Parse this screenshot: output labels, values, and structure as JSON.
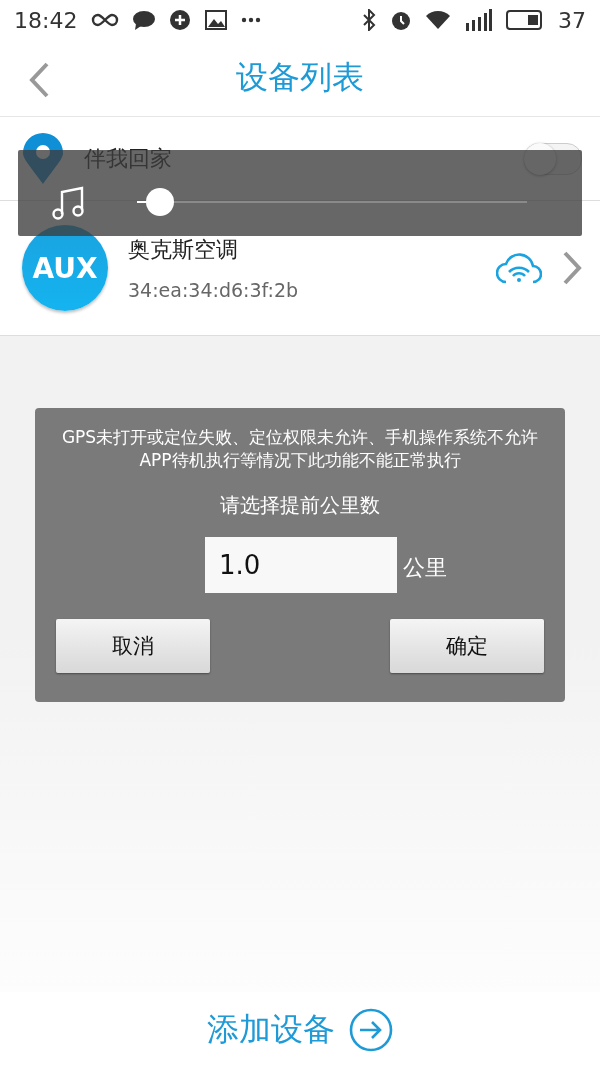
{
  "status_bar": {
    "time": "18:42",
    "battery": "37"
  },
  "header": {
    "title": "设备列表"
  },
  "devices": [
    {
      "kind": "toggle",
      "name": "伴我回家",
      "on": false
    },
    {
      "kind": "device",
      "name": "奥克斯空调",
      "logo": "AUX",
      "mac": "34:ea:34:d6:3f:2b"
    }
  ],
  "volume_overlay": {
    "level": 0.06
  },
  "dialog": {
    "message": "GPS未打开或定位失败、定位权限未允许、手机操作系统不允许APP待机执行等情况下此功能不能正常执行",
    "prompt": "请选择提前公里数",
    "value": "1.0",
    "unit": "公里",
    "buttons": [
      "取消",
      "确定"
    ]
  },
  "bottom_bar": {
    "label": "添加设备"
  }
}
